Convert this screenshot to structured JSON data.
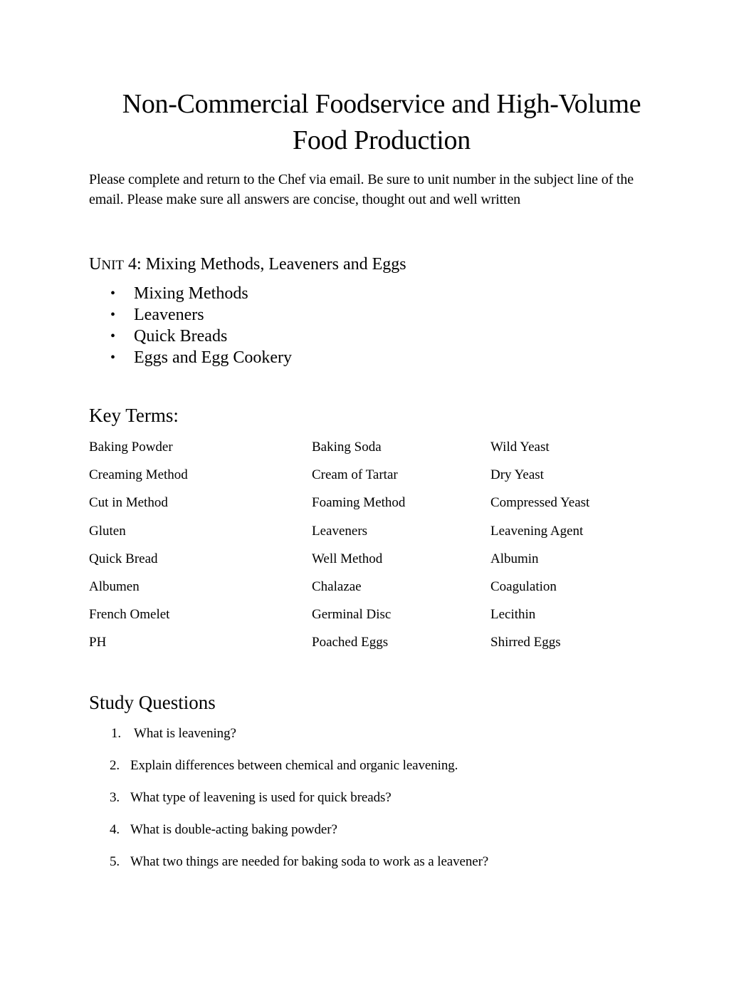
{
  "document": {
    "title_lines": [
      "Non-Commercial Foodservice and High-Volume",
      "Food Production"
    ],
    "intro": "Please complete and return to the Chef via email. Be sure to unit number in the subject line of the email. Please make sure all answers are concise, thought out and well written",
    "unit": {
      "label_first": "U",
      "label_rest": "NIT",
      "title": " 4: Mixing Methods, Leaveners and Eggs",
      "topics": [
        {
          "bullet": "•",
          "text": "Mixing Methods"
        },
        {
          "bullet": "•",
          "text": "Leaveners"
        },
        {
          "bullet": "•",
          "text": "Quick Breads"
        },
        {
          "bullet": "•",
          "text": "Eggs and Egg Cookery"
        }
      ]
    },
    "key_terms": {
      "heading": "Key Terms:",
      "rows": [
        [
          "Baking Powder",
          "Baking Soda",
          "Wild Yeast"
        ],
        [
          "Creaming Method",
          "Cream of Tartar",
          "Dry Yeast"
        ],
        [
          "Cut in Method",
          "Foaming Method",
          "Compressed Yeast"
        ],
        [
          "Gluten",
          "Leaveners",
          "Leavening Agent"
        ],
        [
          "Quick Bread",
          "Well Method",
          "Albumin"
        ],
        [
          "Albumen",
          "Chalazae",
          "Coagulation"
        ],
        [
          "French Omelet",
          "Germinal Disc",
          "Lecithin"
        ],
        [
          "PH",
          "Poached Eggs",
          "Shirred Eggs"
        ]
      ]
    },
    "study_questions": {
      "heading": "Study Questions",
      "items": [
        {
          "num": "1.",
          "text": "What is leavening?"
        },
        {
          "num": "2.",
          "text": "Explain differences between chemical and organic leavening."
        },
        {
          "num": "3.",
          "text": "What type of leavening is used for quick breads?"
        },
        {
          "num": "4.",
          "text": "What is double-acting baking powder?"
        },
        {
          "num": "5.",
          "text": "What two things are needed for baking soda to work as a leavener?"
        }
      ]
    }
  }
}
